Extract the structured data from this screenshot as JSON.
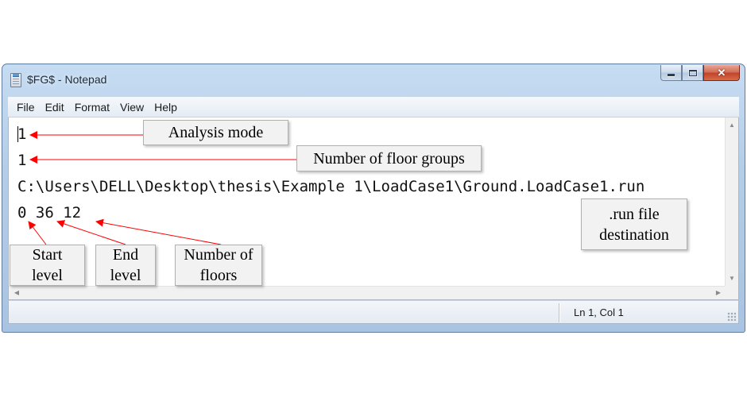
{
  "window": {
    "title": "$FG$ - Notepad"
  },
  "menu": {
    "items": [
      "File",
      "Edit",
      "Format",
      "View",
      "Help"
    ]
  },
  "editor": {
    "lines": [
      "1",
      "1",
      "C:\\Users\\DELL\\Desktop\\thesis\\Example 1\\LoadCase1\\Ground.LoadCase1.run",
      "0 36 12"
    ]
  },
  "statusbar": {
    "position": "Ln 1, Col 1"
  },
  "annotations": {
    "analysis_mode": "Analysis mode",
    "floor_groups": "Number of floor groups",
    "run_file": ".run file destination",
    "start_level": "Start level",
    "end_level": "End level",
    "num_floors": "Number of floors"
  },
  "colors": {
    "arrow": "#ff0000",
    "callout_fill": "#f2f2f2"
  }
}
